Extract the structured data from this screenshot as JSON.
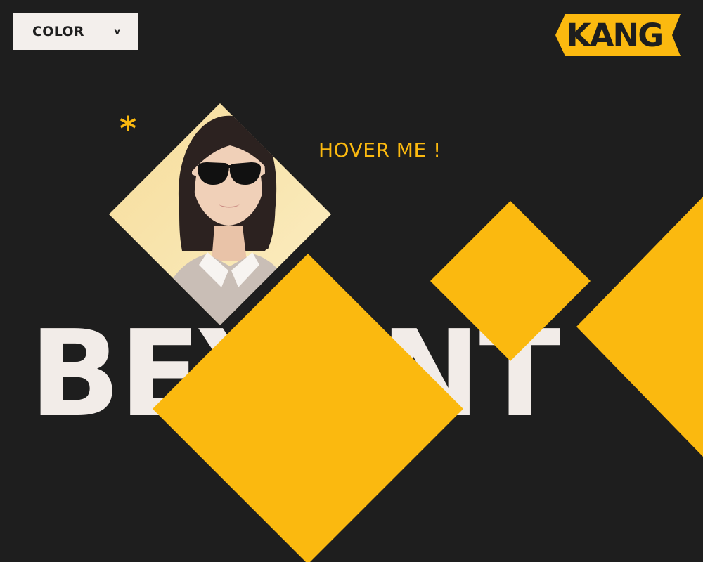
{
  "dropdown": {
    "label": "COLOR",
    "chevron": "v"
  },
  "logo": {
    "text": "KANG"
  },
  "decor": {
    "asterisk": "*"
  },
  "hover": {
    "text": "HOVER ME !"
  },
  "headline": {
    "text": "BEYONT"
  },
  "colors": {
    "background": "#1e1e1e",
    "accent": "#fbb90f",
    "light": "#f2ece8"
  }
}
